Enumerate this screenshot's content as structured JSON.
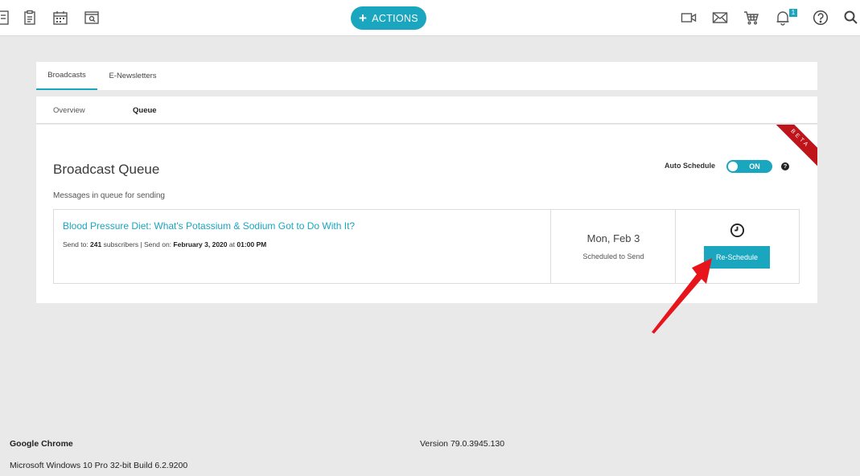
{
  "topbar": {
    "actions_label": "ACTIONS",
    "notification_count": "1",
    "icons": [
      "list-icon",
      "clipboard-icon",
      "calendar-icon",
      "browser-search-icon",
      "video-icon",
      "mail-icon",
      "cart-icon",
      "bell-icon",
      "help-icon",
      "search-icon"
    ]
  },
  "tabs": [
    {
      "label": "Broadcasts",
      "active": true
    },
    {
      "label": "E-Newsletters",
      "active": false
    }
  ],
  "subtabs": [
    {
      "label": "Overview",
      "active": false
    },
    {
      "label": "Queue",
      "active": true
    }
  ],
  "main": {
    "ribbon": "BETA",
    "title": "Broadcast Queue",
    "subtitle": "Messages in queue for sending",
    "auto_schedule_label": "Auto Schedule",
    "toggle_state": "ON",
    "help_glyph": "?"
  },
  "queue": [
    {
      "title": "Blood Pressure Diet: What's Potassium & Sodium Got to Do With It?",
      "send_to_label": "Send to:",
      "subscribers": "241",
      "subscribers_label": "subscribers | Send on:",
      "send_date": "February 3, 2020",
      "at_label": "at",
      "send_time": "01:00 PM",
      "date_display": "Mon, Feb 3",
      "status": "Scheduled to Send",
      "button_label": "Re-Schedule"
    }
  ],
  "system_info": {
    "browser": "Google Chrome",
    "version": "Version 79.0.3945.130",
    "os": "Microsoft Windows 10 Pro 32-bit Build 6.2.9200"
  },
  "colors": {
    "accent": "#1aa6bf",
    "ribbon": "#c0141b",
    "arrow": "#e8141c"
  }
}
